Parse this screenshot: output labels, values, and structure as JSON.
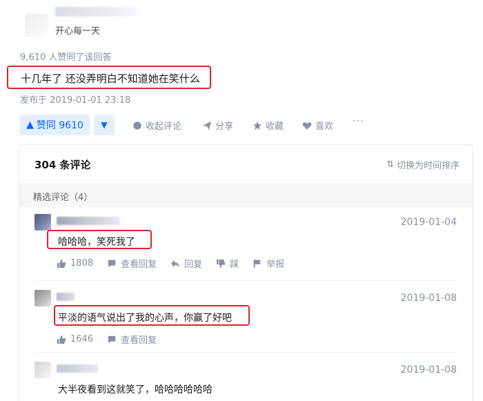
{
  "author": {
    "headline": "开心每一天"
  },
  "answer": {
    "upvote_summary": "9,610 人赞同了该回答",
    "text": "十几年了 还没弄明白不知道她在笑什么",
    "publish_time": "发布于 2019-01-01 23:18"
  },
  "actions": {
    "vote_label": "赞同 9610",
    "collapse_comments": "收起评论",
    "share": "分享",
    "favorite": "收藏",
    "like": "喜欢",
    "more": "···"
  },
  "comments_panel": {
    "count_label": "304 条评论",
    "sort_toggle": "切换为时间排序",
    "featured_label": "精选评论（4）",
    "comments": [
      {
        "date": "2019-01-04",
        "text": "哈哈哈，笑死我了",
        "likes": "1808",
        "view_replies": "查看回复",
        "reply": "回复",
        "dislike": "踩",
        "report": "举报"
      },
      {
        "date": "2019-01-08",
        "text": "平淡的语气说出了我的心声，你赢了好吧",
        "likes": "1646",
        "view_replies": "查看回复"
      },
      {
        "date": "2019-01-08",
        "text": "大半夜看到这就笑了，哈哈哈哈哈哈"
      }
    ]
  },
  "colors": {
    "accent": "#0066ff",
    "highlight_border": "#d9232e",
    "muted": "#8590a6"
  }
}
